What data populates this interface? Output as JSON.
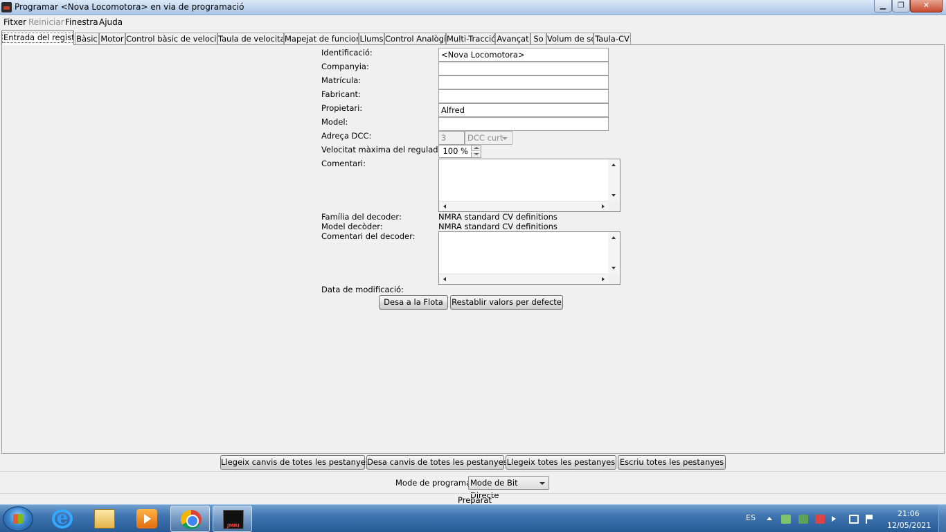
{
  "window": {
    "title": "Programar <Nova Locomotora> en via de programació",
    "min_label": "▁",
    "max_label": "❐",
    "close_label": "✕"
  },
  "menu": [
    "Fitxer",
    "Reiniciar",
    "Finestra",
    "Ajuda"
  ],
  "tabs": [
    "Entrada del registre",
    "Bàsic",
    "Motor",
    "Control bàsic de velocitat",
    "Taula de velocitat",
    "Mapejat de funcions",
    "Llums",
    "Control Analògic",
    "Multi-Tracció",
    "Avançat",
    "So",
    "Volum de so",
    "Taula-CV"
  ],
  "form": {
    "identificacio_label": "Identificació:",
    "identificacio_value": "<Nova Locomotora>",
    "companyia_label": "Companyia:",
    "companyia_value": "",
    "matricula_label": "Matrícula:",
    "matricula_value": "",
    "fabricant_label": "Fabricant:",
    "fabricant_value": "",
    "propietari_label": "Propietari:",
    "propietari_value": "Alfred",
    "model_label": "Model:",
    "model_value": "",
    "adreca_label": "Adreça DCC:",
    "adreca_value": "3",
    "adreca_type": "DCC curt",
    "velocitat_label": "Velocitat màxima del regulador:",
    "velocitat_value": "100 %",
    "comentari_label": "Comentari:",
    "familia_label": "Família del decoder:",
    "familia_value": "NMRA standard CV definitions",
    "model_decoder_label": "Model decòder:",
    "model_decoder_value": "NMRA standard CV definitions",
    "comentari_decoder_label": "Comentari del decoder:",
    "data_label": "Data de modificació:",
    "save_roster_button": "Desa a la Flota",
    "reset_button": "Restablir valors per defecte"
  },
  "actions": {
    "read_changes": "Llegeix canvis de totes les pestanyes",
    "write_changes": "Desa canvis de totes les pestanyes",
    "read_all": "Llegeix totes les pestanyes",
    "write_all": "Escriu totes les pestanyes"
  },
  "mode": {
    "label": "Mode de programació",
    "value": "Mode de Bit Directe"
  },
  "status": "Preparat",
  "taskbar": {
    "apps": [
      "internet-explorer-icon",
      "folder-icon",
      "media-player-icon",
      "chrome-icon",
      "jmri-icon"
    ],
    "jmri_label": "JMRI",
    "language": "ES",
    "time": "21:06",
    "date": "12/05/2021"
  }
}
